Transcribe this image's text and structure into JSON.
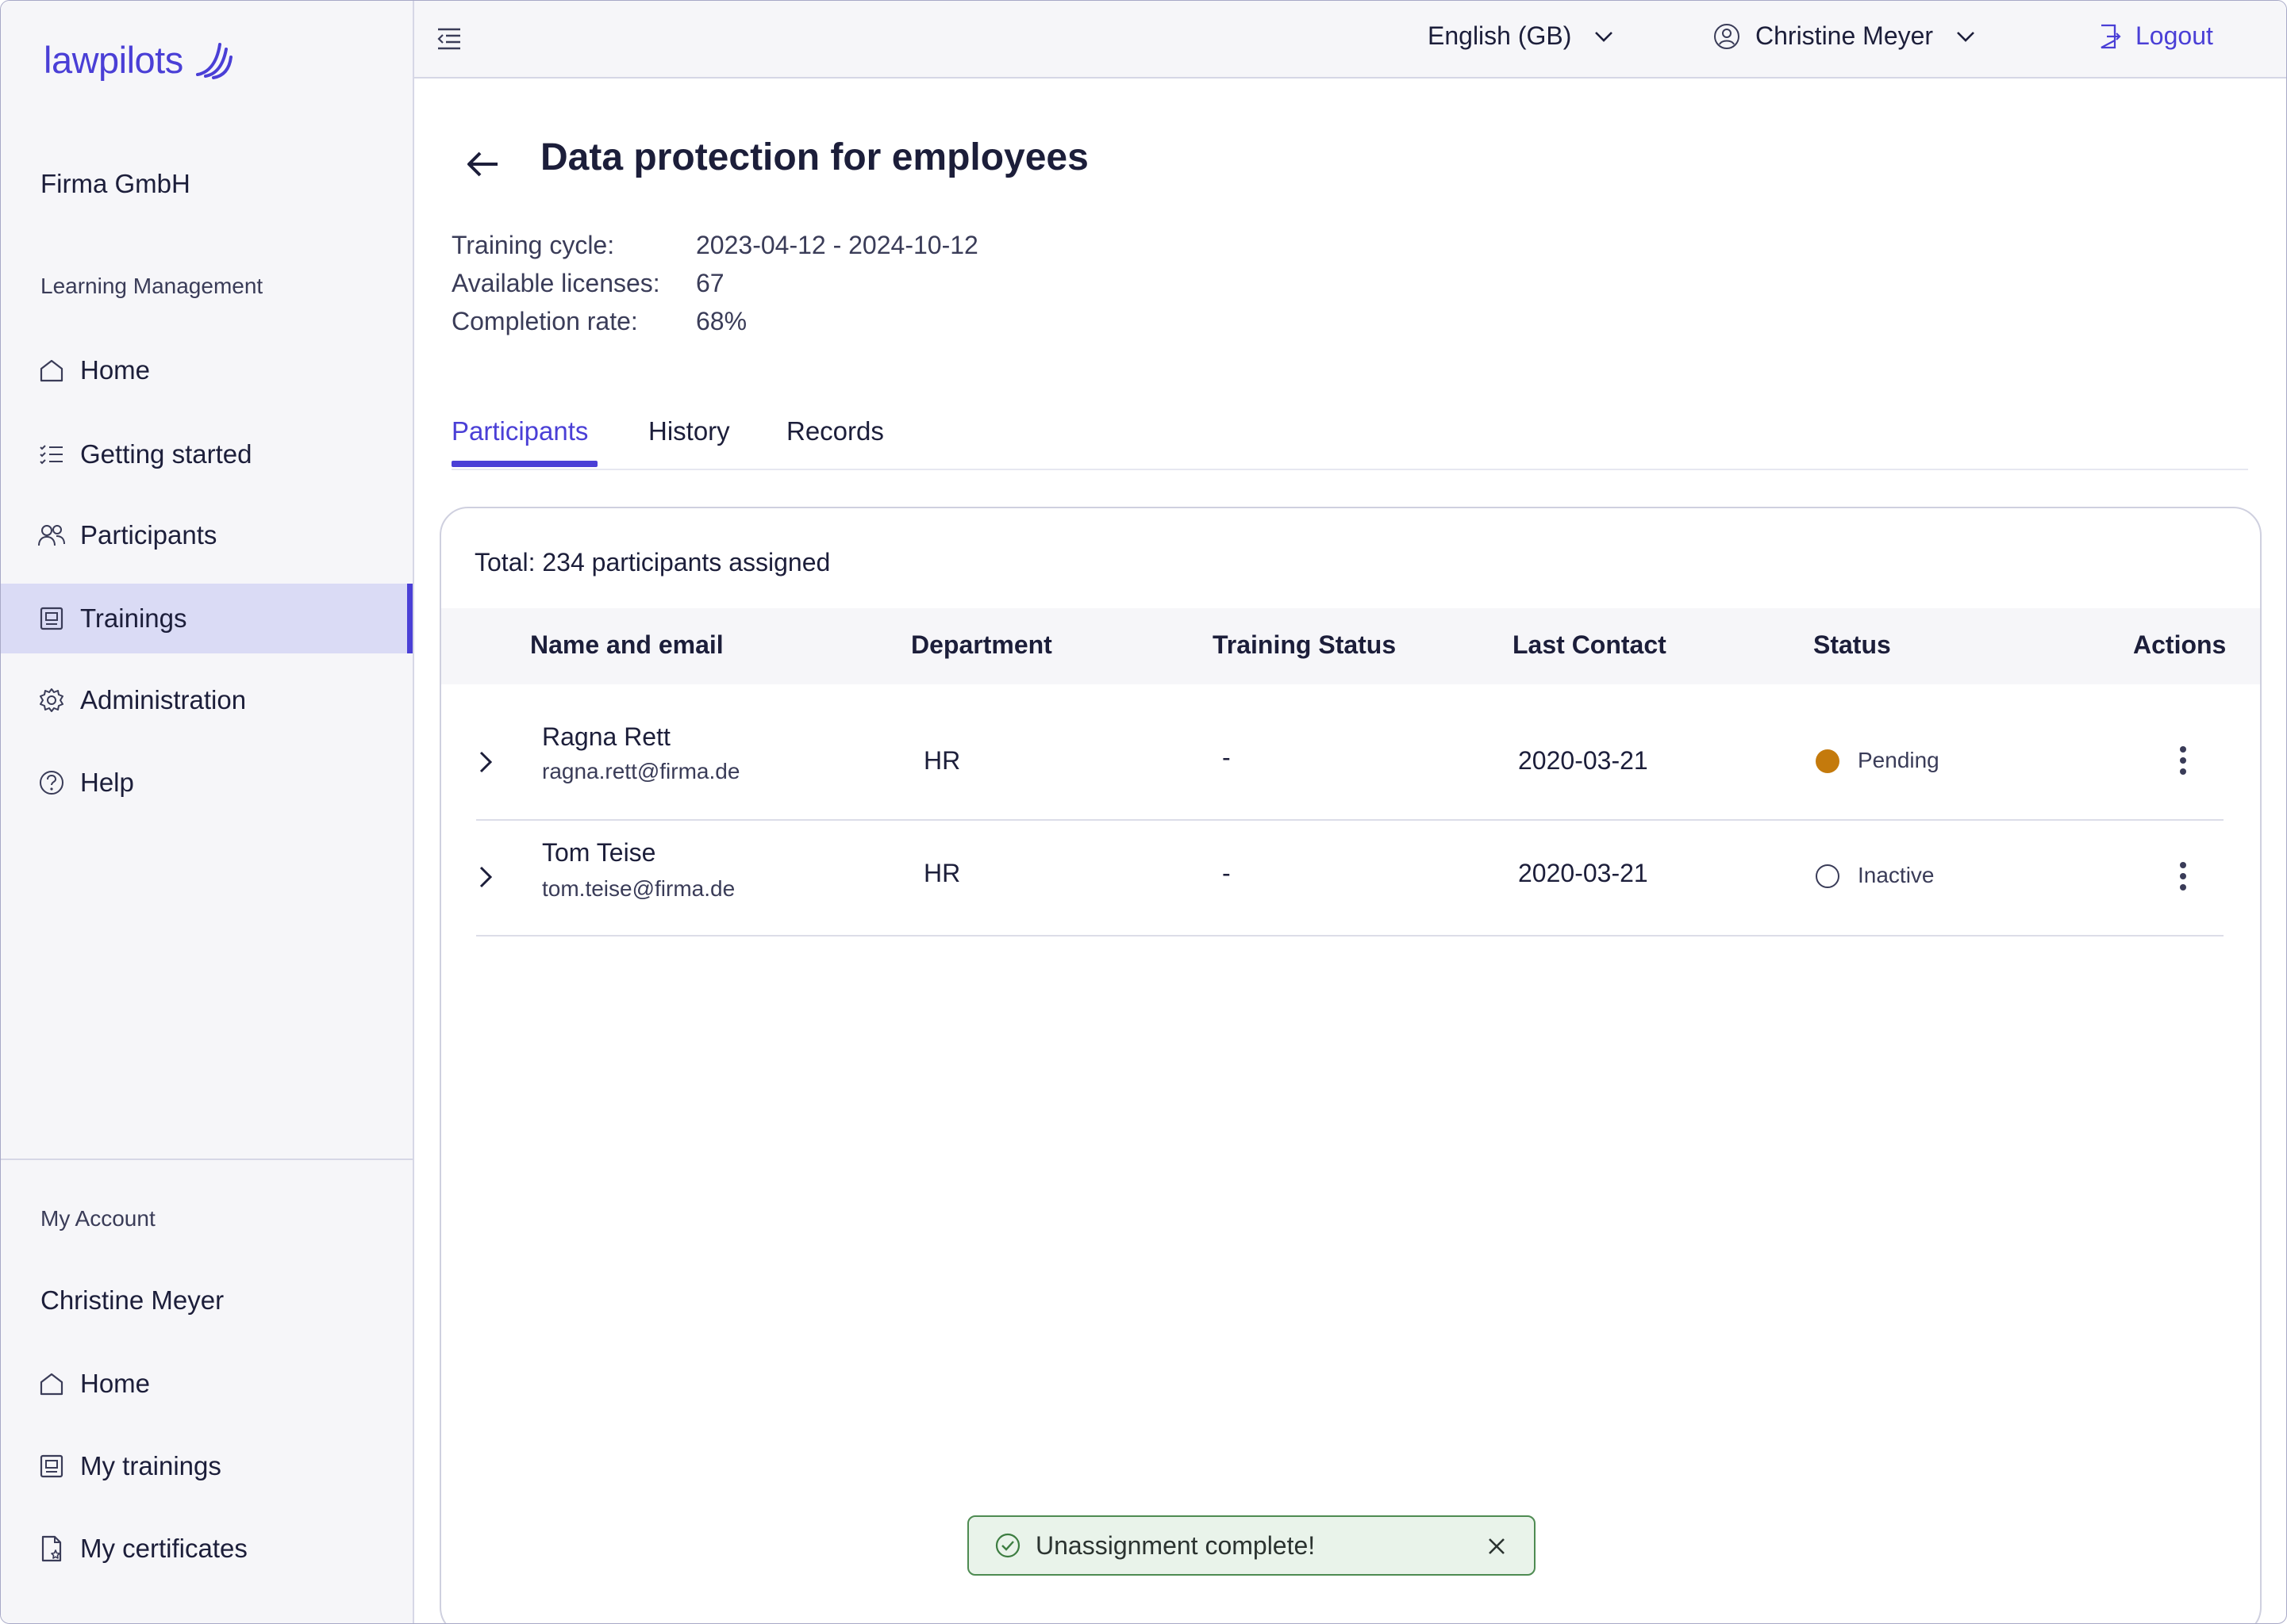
{
  "brand": {
    "name": "lawpilots",
    "color": "#4a3fd6"
  },
  "sidebar": {
    "organization": "Firma GmbH",
    "section_label": "Learning Management",
    "items": [
      {
        "label": "Home",
        "icon": "home-icon"
      },
      {
        "label": "Getting started",
        "icon": "checklist-icon"
      },
      {
        "label": "Participants",
        "icon": "users-icon"
      },
      {
        "label": "Trainings",
        "icon": "training-icon",
        "active": true
      },
      {
        "label": "Administration",
        "icon": "gear-icon"
      },
      {
        "label": "Help",
        "icon": "help-icon"
      }
    ],
    "account": {
      "section_label": "My Account",
      "user_name": "Christine Meyer",
      "items": [
        {
          "label": "Home",
          "icon": "home-icon"
        },
        {
          "label": "My trainings",
          "icon": "training-icon"
        },
        {
          "label": "My certificates",
          "icon": "certificate-icon"
        }
      ]
    }
  },
  "topbar": {
    "language": "English (GB)",
    "user": "Christine Meyer",
    "logout_label": "Logout"
  },
  "page": {
    "title": "Data protection for employees",
    "meta": [
      {
        "label": "Training cycle:",
        "value": "2023-04-12 - 2024-10-12"
      },
      {
        "label": "Available licenses:",
        "value": "67"
      },
      {
        "label": "Completion rate:",
        "value": "68%"
      }
    ],
    "tabs": [
      {
        "label": "Participants",
        "active": true
      },
      {
        "label": "History",
        "active": false
      },
      {
        "label": "Records",
        "active": false
      }
    ]
  },
  "table": {
    "total_text": "Total: 234 participants assigned",
    "headers": [
      "Name and email",
      "Department",
      "Training Status",
      "Last Contact",
      "Status",
      "Actions"
    ],
    "rows": [
      {
        "name": "Ragna Rett",
        "email": "ragna.rett@firma.de",
        "department": "HR",
        "training_status": "-",
        "last_contact": "2020-03-21",
        "status": "Pending",
        "status_color": "#c47a0c"
      },
      {
        "name": "Tom Teise",
        "email": "tom.teise@firma.de",
        "department": "HR",
        "training_status": "-",
        "last_contact": "2020-03-21",
        "status": "Inactive",
        "status_color": "#ffffff"
      }
    ]
  },
  "toast": {
    "message": "Unassignment complete!",
    "color": "#4e8b52"
  }
}
